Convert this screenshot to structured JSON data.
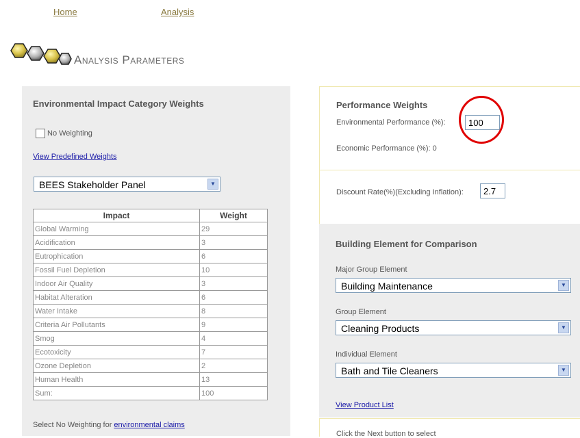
{
  "nav": {
    "home": "Home",
    "analysis": "Analysis"
  },
  "title": "Analysis Parameters",
  "env_weights": {
    "heading": "Environmental Impact Category Weights",
    "no_weighting_label": "No Weighting",
    "no_weighting_checked": false,
    "view_predefined": "View Predefined Weights",
    "panel_select": "BEES Stakeholder Panel",
    "table_headers": [
      "Impact",
      "Weight"
    ],
    "rows": [
      {
        "impact": "Global Warming",
        "weight": "29"
      },
      {
        "impact": "Acidification",
        "weight": "3"
      },
      {
        "impact": "Eutrophication",
        "weight": "6"
      },
      {
        "impact": "Fossil Fuel Depletion",
        "weight": "10"
      },
      {
        "impact": "Indoor Air Quality",
        "weight": "3"
      },
      {
        "impact": "Habitat Alteration",
        "weight": "6"
      },
      {
        "impact": "Water Intake",
        "weight": "8"
      },
      {
        "impact": "Criteria Air Pollutants",
        "weight": "9"
      },
      {
        "impact": "Smog",
        "weight": "4"
      },
      {
        "impact": "Ecotoxicity",
        "weight": "7"
      },
      {
        "impact": "Ozone Depletion",
        "weight": "2"
      },
      {
        "impact": "Human Health",
        "weight": "13"
      },
      {
        "impact": "Sum:",
        "weight": "100"
      }
    ],
    "footer_text": "Select No Weighting for ",
    "footer_link": "environmental claims"
  },
  "performance": {
    "heading": "Performance Weights",
    "env_label": "Environmental Performance (%):",
    "env_value": "100",
    "econ_label": "Economic Performance (%): 0"
  },
  "discount": {
    "label": "Discount Rate(%)(Excluding Inflation):",
    "value": "2.7"
  },
  "building": {
    "heading": "Building Element for Comparison",
    "major_label": "Major Group Element",
    "major_value": "Building Maintenance",
    "group_label": "Group Element",
    "group_value": "Cleaning Products",
    "individual_label": "Individual Element",
    "individual_value": "Bath and Tile Cleaners",
    "view_products": "View Product List"
  },
  "next_hint": "Click the Next button to select",
  "colors": {
    "annotation_circle": "#e00000",
    "panel_gray": "#ededed",
    "link_blue": "#1a1aa8"
  }
}
